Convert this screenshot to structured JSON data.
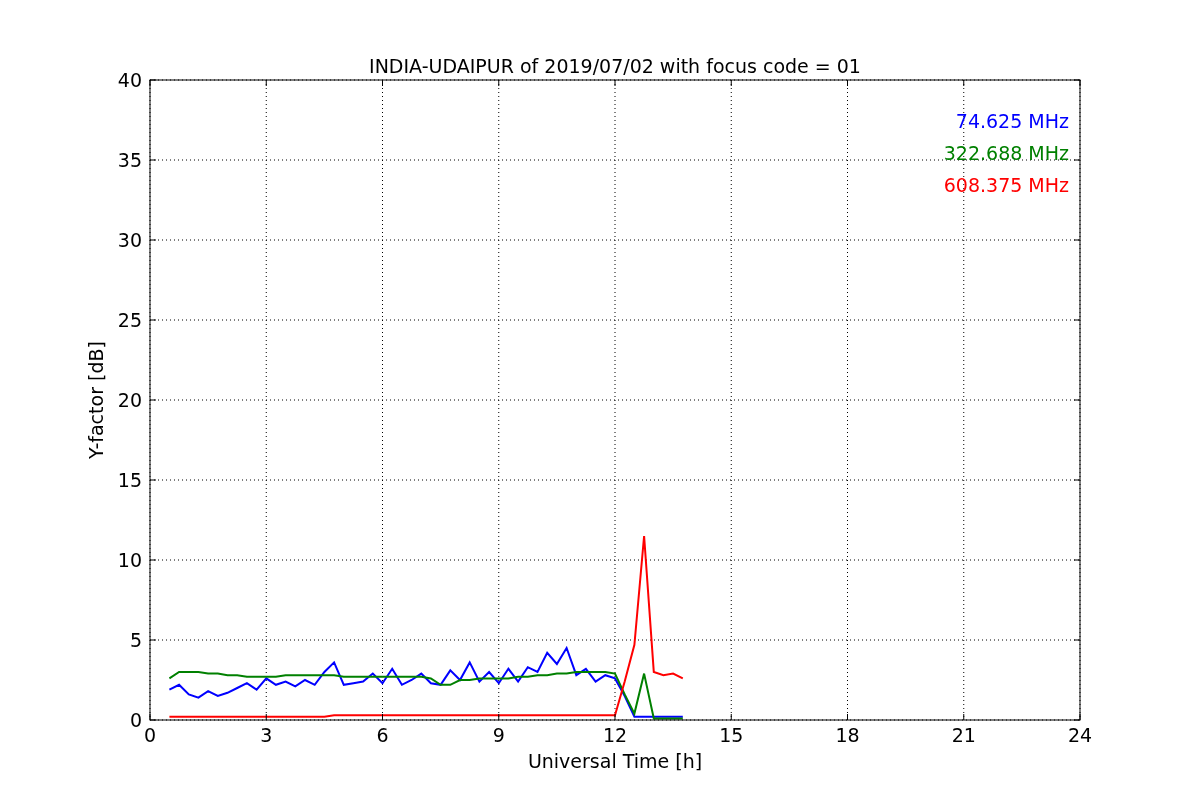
{
  "chart_data": {
    "type": "line",
    "title": "INDIA-UDAIPUR of 2019/07/02 with focus code = 01",
    "xlabel": "Universal Time [h]",
    "ylabel": "Y-factor [dB]",
    "x": [
      0.5,
      0.75,
      1,
      1.25,
      1.5,
      1.75,
      2,
      2.25,
      2.5,
      2.75,
      3,
      3.25,
      3.5,
      3.75,
      4,
      4.25,
      4.5,
      4.75,
      5,
      5.25,
      5.5,
      5.75,
      6,
      6.25,
      6.5,
      6.75,
      7,
      7.25,
      7.5,
      7.75,
      8,
      8.25,
      8.5,
      8.75,
      9,
      9.25,
      9.5,
      9.75,
      10,
      10.25,
      10.5,
      10.75,
      11,
      11.25,
      11.5,
      11.75,
      12,
      12.25,
      12.5,
      12.75,
      13,
      13.25,
      13.5,
      13.75
    ],
    "series": [
      {
        "name": "74.625 MHz",
        "color": "#0000ff",
        "values": [
          1.9,
          2.2,
          1.6,
          1.4,
          1.8,
          1.5,
          1.7,
          2.0,
          2.3,
          1.9,
          2.6,
          2.2,
          2.4,
          2.1,
          2.5,
          2.2,
          3.0,
          3.6,
          2.2,
          2.3,
          2.4,
          2.9,
          2.3,
          3.2,
          2.2,
          2.5,
          2.9,
          2.3,
          2.2,
          3.1,
          2.5,
          3.6,
          2.4,
          3.0,
          2.3,
          3.2,
          2.4,
          3.3,
          3.0,
          4.2,
          3.5,
          4.5,
          2.8,
          3.2,
          2.4,
          2.8,
          2.6,
          1.5,
          0.2,
          0.2,
          0.2,
          0.2,
          0.2,
          0.2
        ]
      },
      {
        "name": "322.688 MHz",
        "color": "#008000",
        "values": [
          2.6,
          3.0,
          3.0,
          3.0,
          2.9,
          2.9,
          2.8,
          2.8,
          2.7,
          2.7,
          2.7,
          2.7,
          2.8,
          2.8,
          2.8,
          2.8,
          2.8,
          2.8,
          2.7,
          2.7,
          2.7,
          2.7,
          2.7,
          2.7,
          2.7,
          2.7,
          2.7,
          2.6,
          2.2,
          2.2,
          2.5,
          2.5,
          2.6,
          2.6,
          2.6,
          2.6,
          2.7,
          2.7,
          2.8,
          2.8,
          2.9,
          2.9,
          3.0,
          3.0,
          3.0,
          3.0,
          2.9,
          1.6,
          0.4,
          2.9,
          0.1,
          0.1,
          0.1,
          0.1
        ]
      },
      {
        "name": "608.375 MHz",
        "color": "#ff0000",
        "values": [
          0.2,
          0.2,
          0.2,
          0.2,
          0.2,
          0.2,
          0.2,
          0.2,
          0.2,
          0.2,
          0.2,
          0.2,
          0.2,
          0.2,
          0.2,
          0.2,
          0.2,
          0.3,
          0.3,
          0.3,
          0.3,
          0.3,
          0.3,
          0.3,
          0.3,
          0.3,
          0.3,
          0.3,
          0.3,
          0.3,
          0.3,
          0.3,
          0.3,
          0.3,
          0.3,
          0.3,
          0.3,
          0.3,
          0.3,
          0.3,
          0.3,
          0.3,
          0.3,
          0.3,
          0.3,
          0.3,
          0.3,
          2.4,
          4.7,
          11.5,
          3.0,
          2.8,
          2.9,
          2.6
        ]
      }
    ],
    "grid": true,
    "xlim": [
      0,
      24
    ],
    "ylim": [
      0,
      40
    ],
    "xticks": [
      0,
      3,
      6,
      9,
      12,
      15,
      18,
      21,
      24
    ],
    "yticks": [
      0,
      5,
      10,
      15,
      20,
      25,
      30,
      35,
      40
    ]
  }
}
